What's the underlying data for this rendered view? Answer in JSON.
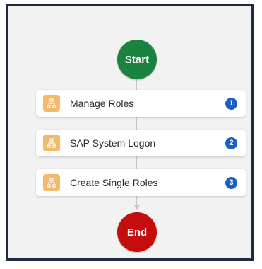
{
  "flow": {
    "start_label": "Start",
    "end_label": "End",
    "steps": [
      {
        "label": "Manage Roles",
        "number": "1",
        "icon": "hierarchy-icon"
      },
      {
        "label": "SAP System Logon",
        "number": "2",
        "icon": "hierarchy-icon"
      },
      {
        "label": "Create Single Roles",
        "number": "3",
        "icon": "hierarchy-icon"
      }
    ]
  },
  "colors": {
    "frame_border": "#1e2a44",
    "canvas_bg": "#f2f2f2",
    "start": "#19833f",
    "end": "#c40d0d",
    "step_icon": "#f4ba6b",
    "badge": "#1a5fc2",
    "connector": "#c4c4c4"
  }
}
